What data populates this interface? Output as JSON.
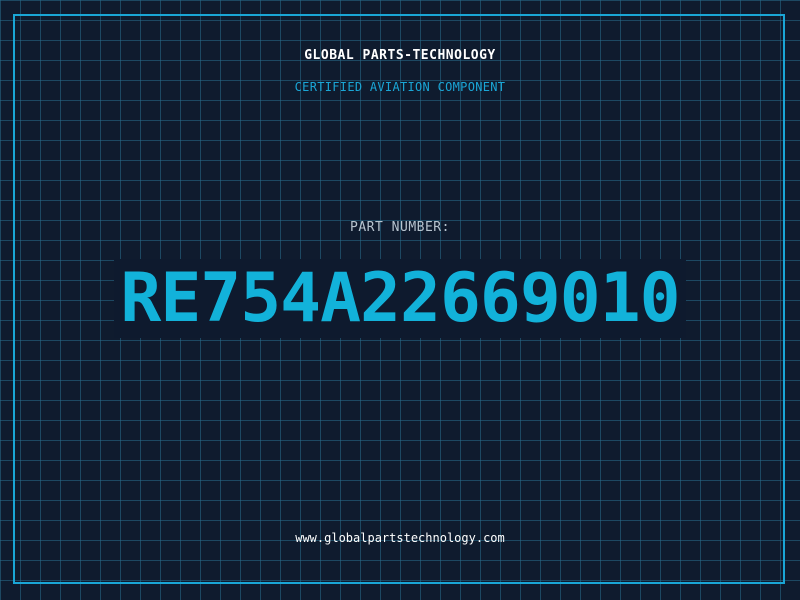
{
  "header": {
    "company": "GLOBAL PARTS-TECHNOLOGY",
    "tagline": "CERTIFIED AVIATION COMPONENT"
  },
  "part": {
    "label": "PART NUMBER:",
    "number": "RE754A22669010"
  },
  "footer": {
    "website": "www.globalpartstechnology.com"
  },
  "colors": {
    "background": "#0f1b2e",
    "grid": "#286e8c",
    "accent": "#1aa6d6",
    "text_primary": "#ffffff",
    "text_muted": "#b8c4cf"
  }
}
